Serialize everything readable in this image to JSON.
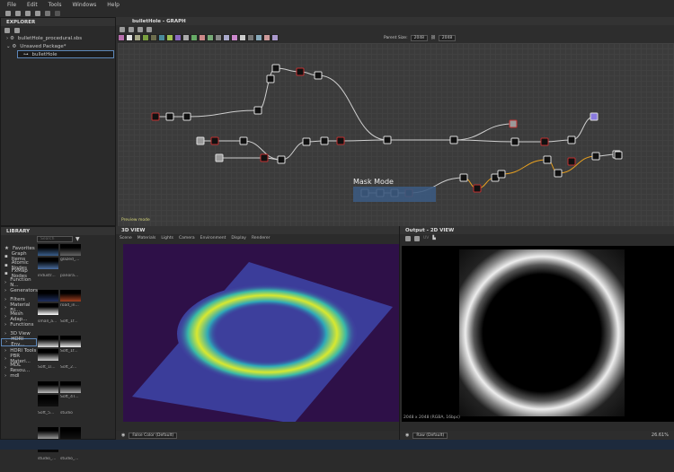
{
  "menu": [
    "File",
    "Edit",
    "Tools",
    "Windows",
    "Help"
  ],
  "explorer": {
    "title": "EXPLORER",
    "items": [
      {
        "label": "bulletHole_procedural.sbs"
      },
      {
        "label": "Unsaved Package*"
      },
      {
        "label": "bulletHole"
      }
    ]
  },
  "graph": {
    "title": "bulletHole - GRAPH",
    "parent_size_label": "Parent Size:",
    "width": "2048",
    "height": "2048",
    "frame_label": "Mask Mode",
    "preview_mode": "Preview mode",
    "swatch_colors": [
      "#b86fae",
      "#e0e0e0",
      "#a7a888",
      "#7aa040",
      "#6d6d4d",
      "#4a8a9a",
      "#9fc150",
      "#8a6ac0",
      "#aaa",
      "#6a6",
      "#c88",
      "#7a7",
      "#888",
      "#aac",
      "#c8c",
      "#ccc",
      "#777",
      "#8ab",
      "#c99",
      "#a9c"
    ]
  },
  "library": {
    "title": "LIBRARY",
    "search_placeholder": "Search",
    "items": [
      {
        "label": "Favorites",
        "icon": "star-icon"
      },
      {
        "label": "Graph Items"
      },
      {
        "label": "Atomic Nodes"
      },
      {
        "label": "FxMap Nodes"
      },
      {
        "label": "Function N..."
      },
      {
        "label": "Generators"
      },
      {
        "label": "Filters"
      },
      {
        "label": "Material Fil..."
      },
      {
        "label": "Mesh Adap..."
      },
      {
        "label": "Functions"
      },
      {
        "label": "3D View"
      },
      {
        "label": "HDRI Env..."
      },
      {
        "label": "HDRI Tools"
      },
      {
        "label": "PBR Materi..."
      },
      {
        "label": "MDL Resou..."
      },
      {
        "label": "mdl"
      }
    ],
    "thumbs": [
      "glazed_...",
      "industr...",
      "panora...",
      "road_in...",
      "small_a...",
      "Soft_1f...",
      "Soft_1f...",
      "Soft_1l...",
      "Soft_2...",
      "Soft_4T...",
      "Soft_5...",
      "studio",
      "studio 02",
      "studio_...",
      "studio_..."
    ]
  },
  "view3d": {
    "title": "3D VIEW",
    "tabs": [
      "Scene",
      "Materials",
      "Lights",
      "Camera",
      "Environment",
      "Display",
      "Renderer"
    ],
    "colormap": "False Color (Default)"
  },
  "view2d": {
    "title": "Output - 2D VIEW",
    "uv_label": "UV",
    "info": "2048 x 2048 (RGBA, 16bpc)",
    "colormap": "Raw (Default)",
    "zoom": "26.61%"
  },
  "colors": {
    "bg": "#2b2b2b",
    "viewport3d": "#2e1048",
    "accent_orange": "#e8a020",
    "selection": "#5d87b8"
  }
}
